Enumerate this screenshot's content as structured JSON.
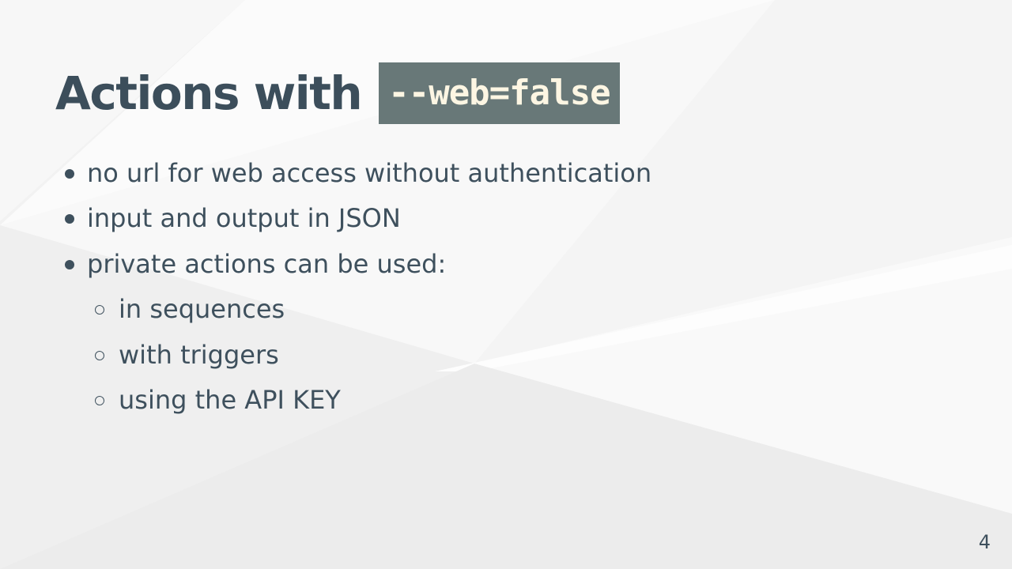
{
  "slide": {
    "title": "Actions with",
    "title_code": "--web=false",
    "bullets": [
      {
        "text": "no url for web access without authentication",
        "level": 1
      },
      {
        "text": "input and output in JSON",
        "level": 1
      },
      {
        "text": "private actions can be used:",
        "level": 1
      },
      {
        "text": "in sequences",
        "level": 2
      },
      {
        "text": "with triggers",
        "level": 2
      },
      {
        "text": "using the API KEY",
        "level": 2
      }
    ],
    "page_number": "4"
  },
  "colors": {
    "background": "#f3f3f3",
    "text": "#3e505d",
    "code_background": "#687878",
    "code_text": "#fdf6e3"
  }
}
